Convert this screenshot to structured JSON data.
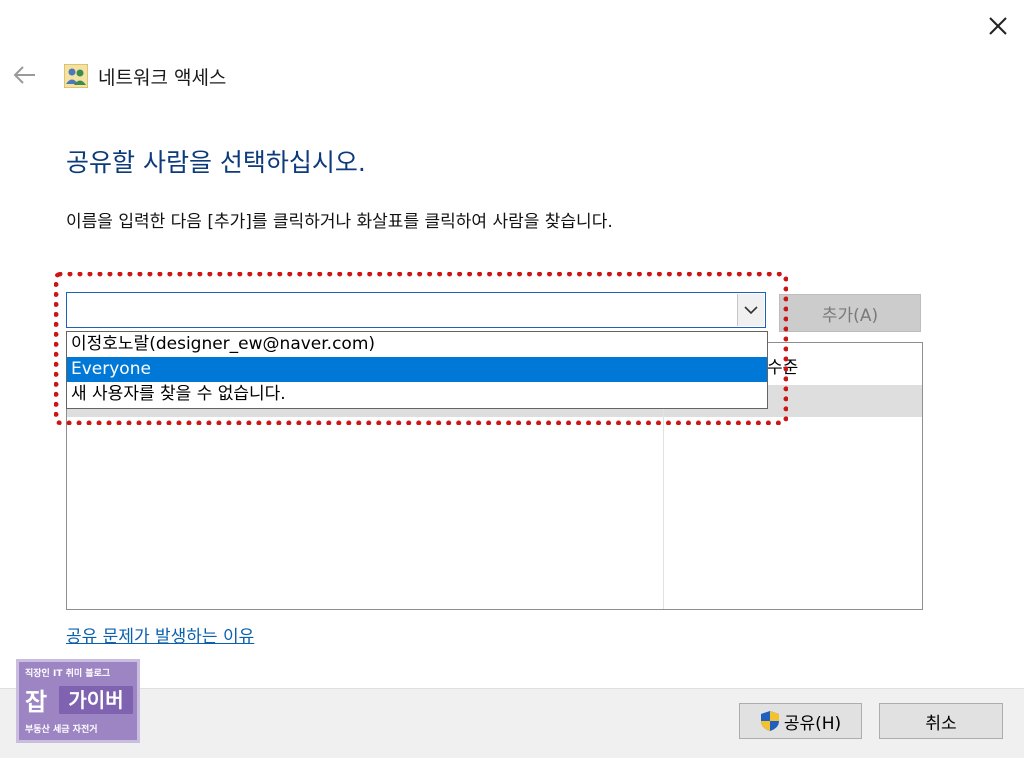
{
  "window": {
    "title": "네트워크 액세스",
    "icons": {
      "close": "close-icon",
      "back": "back-arrow-icon",
      "title": "network-users-icon"
    }
  },
  "main": {
    "heading": "공유할 사람을 선택하십시오.",
    "instruction": "이름을 입력한 다음 [추가]를 클릭하거나 화살표를 클릭하여 사람을 찾습니다.",
    "combo": {
      "value": "",
      "arrow_icon": "chevron-down-icon"
    },
    "add_button": "추가(A)",
    "dropdown_items": [
      {
        "label": "이정호노랄(designer_ew@naver.com)",
        "selected": false
      },
      {
        "label": "Everyone",
        "selected": true
      },
      {
        "label": "새 사용자를 찾을 수 없습니다.",
        "selected": false
      }
    ],
    "table": {
      "permission_header_partial": "수준"
    },
    "help_link": "공유 문제가 발생하는 이유"
  },
  "footer": {
    "share_button": "공유(H)",
    "share_icon": "uac-shield-icon",
    "cancel_button": "취소"
  },
  "watermark": {
    "top_text": "직장인 IT 취미 블로그",
    "big_char": "잡",
    "box_text": "가이버",
    "bottom_text": "부동산 세금 자전거"
  },
  "colors": {
    "accent": "#0078d7",
    "heading": "#0c3a7a",
    "link": "#0a5fae",
    "marker": "#cc1515"
  }
}
